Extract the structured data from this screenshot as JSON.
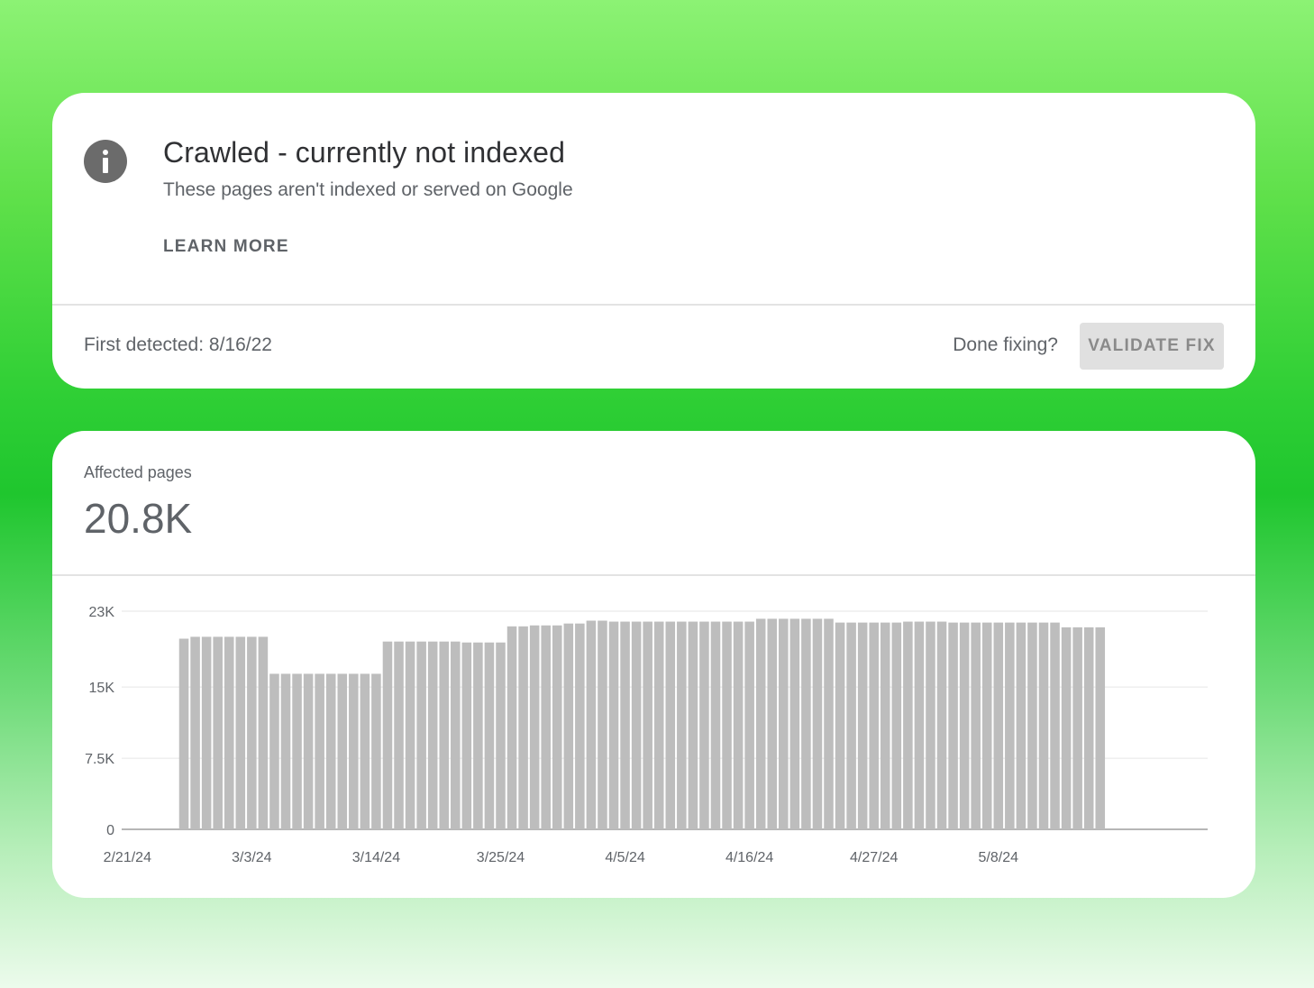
{
  "issue": {
    "title": "Crawled - currently not indexed",
    "subtitle": "These pages aren't indexed or served on Google",
    "learn_more": "LEARN MORE",
    "icon": "info-icon"
  },
  "footer": {
    "first_detected": "First detected: 8/16/22",
    "done_fixing": "Done fixing?",
    "validate_fix": "VALIDATE FIX"
  },
  "metric": {
    "label": "Affected pages",
    "value": "20.8K"
  },
  "colors": {
    "bar": "#bdbdbd",
    "icon": "#6b6b6b",
    "text": "#5f6368"
  },
  "chart_data": {
    "type": "bar",
    "ylim": [
      0,
      23000
    ],
    "yticks": [
      0,
      7500,
      15000,
      23000
    ],
    "ytick_labels": [
      "0",
      "7.5K",
      "15K",
      "23K"
    ],
    "xtick_labels": [
      "2/21/24",
      "3/3/24",
      "3/14/24",
      "3/25/24",
      "4/5/24",
      "4/16/24",
      "4/27/24",
      "5/8/24"
    ],
    "grid": true,
    "categories": [
      "2/21/24",
      "2/22/24",
      "2/23/24",
      "2/24/24",
      "2/25/24",
      "2/26/24",
      "2/27/24",
      "2/28/24",
      "2/29/24",
      "3/1/24",
      "3/2/24",
      "3/3/24",
      "3/4/24",
      "3/5/24",
      "3/6/24",
      "3/7/24",
      "3/8/24",
      "3/9/24",
      "3/10/24",
      "3/11/24",
      "3/12/24",
      "3/13/24",
      "3/14/24",
      "3/15/24",
      "3/16/24",
      "3/17/24",
      "3/18/24",
      "3/19/24",
      "3/20/24",
      "3/21/24",
      "3/22/24",
      "3/23/24",
      "3/24/24",
      "3/25/24",
      "3/26/24",
      "3/27/24",
      "3/28/24",
      "3/29/24",
      "3/30/24",
      "3/31/24",
      "4/1/24",
      "4/2/24",
      "4/3/24",
      "4/4/24",
      "4/5/24",
      "4/6/24",
      "4/7/24",
      "4/8/24",
      "4/9/24",
      "4/10/24",
      "4/11/24",
      "4/12/24",
      "4/13/24",
      "4/14/24",
      "4/15/24",
      "4/16/24",
      "4/17/24",
      "4/18/24",
      "4/19/24",
      "4/20/24",
      "4/21/24",
      "4/22/24",
      "4/23/24",
      "4/24/24",
      "4/25/24",
      "4/26/24",
      "4/27/24",
      "4/28/24",
      "4/29/24",
      "4/30/24",
      "5/1/24",
      "5/2/24",
      "5/3/24",
      "5/4/24",
      "5/5/24",
      "5/6/24",
      "5/7/24",
      "5/8/24",
      "5/9/24",
      "5/10/24",
      "5/11/24",
      "5/12/24",
      "5/13/24",
      "5/14/24",
      "5/15/24",
      "5/16/24",
      "5/17/24",
      "5/18/24",
      "5/19/24",
      "5/20/24",
      "5/21/24",
      "5/22/24",
      "5/23/24",
      "5/24/24",
      "5/25/24",
      "5/26/24"
    ],
    "values": [
      null,
      null,
      null,
      null,
      null,
      20100,
      20300,
      20300,
      20300,
      20300,
      20300,
      20300,
      20300,
      16400,
      16400,
      16400,
      16400,
      16400,
      16400,
      16400,
      16400,
      16400,
      16400,
      19800,
      19800,
      19800,
      19800,
      19800,
      19800,
      19800,
      19700,
      19700,
      19700,
      19700,
      21400,
      21400,
      21500,
      21500,
      21500,
      21700,
      21700,
      22000,
      22000,
      21900,
      21900,
      21900,
      21900,
      21900,
      21900,
      21900,
      21900,
      21900,
      21900,
      21900,
      21900,
      21900,
      22200,
      22200,
      22200,
      22200,
      22200,
      22200,
      22200,
      21800,
      21800,
      21800,
      21800,
      21800,
      21800,
      21900,
      21900,
      21900,
      21900,
      21800,
      21800,
      21800,
      21800,
      21800,
      21800,
      21800,
      21800,
      21800,
      21800,
      21300,
      21300,
      21300,
      21300,
      null
    ]
  }
}
